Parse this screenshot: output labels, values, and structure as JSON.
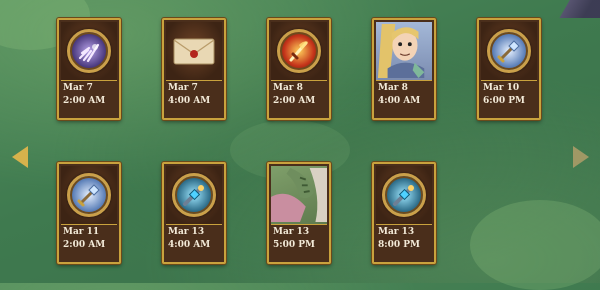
{
  "cards": [
    {
      "date": "Mar 7",
      "time": "2:00 AM",
      "icon": "magic-hand-icon"
    },
    {
      "date": "Mar 7",
      "time": "4:00 AM",
      "icon": "sealed-letter-icon"
    },
    {
      "date": "Mar 8",
      "time": "2:00 AM",
      "icon": "fire-sword-icon"
    },
    {
      "date": "Mar 8",
      "time": "4:00 AM",
      "icon": "hero-portrait-icon"
    },
    {
      "date": "Mar 10",
      "time": "6:00 PM",
      "icon": "gem-staff-icon"
    },
    {
      "date": "Mar 11",
      "time": "2:00 AM",
      "icon": "gem-staff-icon"
    },
    {
      "date": "Mar 13",
      "time": "4:00 AM",
      "icon": "blue-gem-weapon-icon"
    },
    {
      "date": "Mar 13",
      "time": "5:00 PM",
      "icon": "creature-portrait-icon"
    },
    {
      "date": "Mar 13",
      "time": "8:00 PM",
      "icon": "blue-gem-weapon-icon"
    }
  ],
  "navigation": {
    "prev": "arrow-left-icon",
    "next": "arrow-right-icon"
  },
  "colors": {
    "frame": "#c9a23d",
    "card_bg": "#4a2e1b",
    "text": "#f3ead8",
    "background": "#3f7a4f"
  }
}
